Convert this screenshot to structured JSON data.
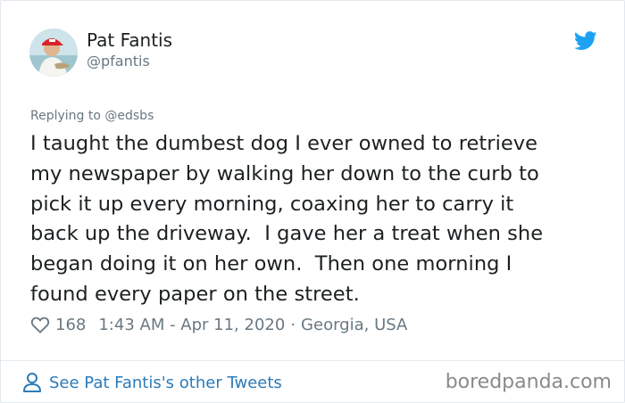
{
  "author": {
    "name": "Pat Fantis",
    "handle": "@pfantis"
  },
  "reply": {
    "prefix": "Replying to",
    "mention": "@edsbs"
  },
  "tweet": {
    "lines": [
      "I taught the dumbest dog I ever owned to retrieve",
      "my newspaper by walking her down to the curb to",
      "pick it up every morning, coaxing her to carry it",
      "back up the driveway.  I gave her a treat when she",
      "began doing it on her own.  Then one morning I",
      "found every paper on the street."
    ]
  },
  "meta": {
    "likes": "168",
    "time": "1:43 AM - Apr 11, 2020",
    "separator": "·",
    "location": "Georgia, USA"
  },
  "footer": {
    "link_label": "See Pat Fantis's other Tweets",
    "watermark": "boredpanda.com"
  },
  "colors": {
    "twitter_blue": "#1da1f2",
    "link_blue": "#2b7bb9",
    "muted": "#697882"
  },
  "icons": {
    "brand": "twitter-bird-icon",
    "like": "heart-icon",
    "profile": "person-icon"
  }
}
